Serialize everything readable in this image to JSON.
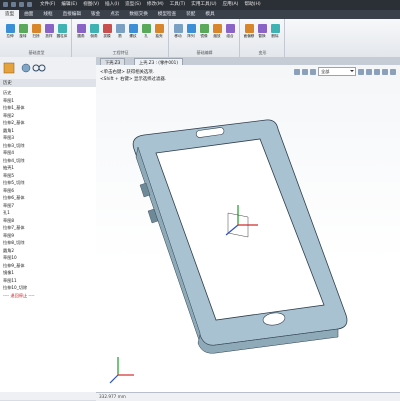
{
  "titlebar": {
    "menus": [
      "文件(F)",
      "编辑(E)",
      "视图(V)",
      "插入(I)",
      "造型(S)",
      "修改(M)",
      "工具(T)",
      "实用工具(U)",
      "应用(A)",
      "帮助(H)"
    ]
  },
  "ribbon": {
    "tabs": [
      "造型",
      "曲面",
      "线框",
      "直接编辑",
      "钣金",
      "点云",
      "数据交换",
      "模型检查",
      "装配",
      "模具"
    ],
    "active_tab": "造型",
    "groups": [
      {
        "label": "基础造型",
        "buttons": [
          "拉伸",
          "旋转",
          "扫掠",
          "放样",
          "圆柱体"
        ]
      },
      {
        "label": "工程特征",
        "buttons": [
          "圆角",
          "倒角",
          "拔模",
          "筋",
          "螺纹",
          "孔",
          "抽壳"
        ]
      },
      {
        "label": "基础编辑",
        "buttons": [
          "移动",
          "阵列",
          "镜像",
          "缩放",
          "组合"
        ]
      },
      {
        "label": "变形",
        "buttons": [
          "面偏移",
          "替换",
          "删除"
        ]
      }
    ]
  },
  "tree": {
    "title": "历史",
    "rows": [
      {
        "text": "历史",
        "red": false
      },
      {
        "text": "   草图1",
        "red": false
      },
      {
        "text": "   拉伸1_基体",
        "red": false
      },
      {
        "text": "   草图2",
        "red": false
      },
      {
        "text": "   拉伸2_基体",
        "red": false
      },
      {
        "text": "   圆角1",
        "red": false
      },
      {
        "text": "   草图3",
        "red": false
      },
      {
        "text": "   拉伸3_切除",
        "red": false
      },
      {
        "text": "   草图4",
        "red": false
      },
      {
        "text": "   拉伸4_切除",
        "red": false
      },
      {
        "text": "   抽壳1",
        "red": false
      },
      {
        "text": "   草图5",
        "red": false
      },
      {
        "text": "   拉伸5_切除",
        "red": false
      },
      {
        "text": "   草图6",
        "red": false
      },
      {
        "text": "   拉伸6_基体",
        "red": false
      },
      {
        "text": "   草图7",
        "red": false
      },
      {
        "text": "   孔1",
        "red": false
      },
      {
        "text": "   草图8",
        "red": false
      },
      {
        "text": "   拉伸7_基体",
        "red": false
      },
      {
        "text": "   草图9",
        "red": false
      },
      {
        "text": "   拉伸8_切除",
        "red": false
      },
      {
        "text": "   圆角2",
        "red": false
      },
      {
        "text": "   草图10",
        "red": false
      },
      {
        "text": "   拉伸9_基体",
        "red": false
      },
      {
        "text": "   镜像1",
        "red": false
      },
      {
        "text": "   草图11",
        "red": false
      },
      {
        "text": "   拉伸10_切除",
        "red": false
      },
      {
        "text": "   ---- 退回停止 ----",
        "red": true
      }
    ]
  },
  "doctabs": [
    "下壳.Z3",
    "上壳.Z3 : (零件001)"
  ],
  "active_doctab": 1,
  "viewport": {
    "hints": [
      "<单击右键> 获得相关选项.",
      "<Shift + 右键> 显示选择过滤器."
    ],
    "filter_value": "全部"
  },
  "status": {
    "text": "332.977 mm"
  },
  "colors": {
    "model_fill": "#a9c2d2",
    "model_stroke": "#2e3e4c",
    "accent": "#d4a017"
  }
}
